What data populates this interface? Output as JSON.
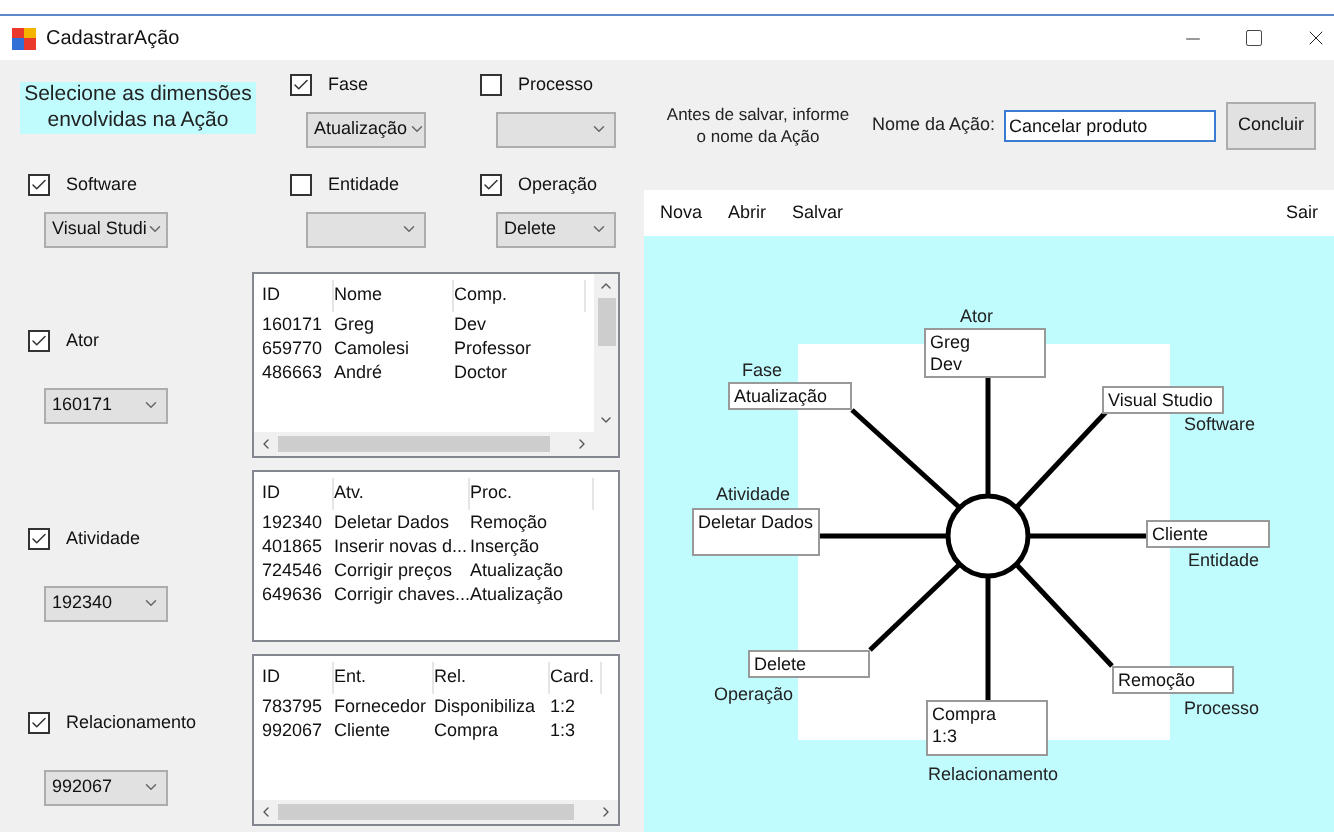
{
  "window": {
    "title": "CadastrarAção"
  },
  "instruction": "Selecione as dimensões envolvidas na Ação",
  "top_dimensions": [
    {
      "label": "Fase",
      "checked": true,
      "value": "Atualização"
    },
    {
      "label": "Processo",
      "checked": false
    },
    {
      "label": "Software",
      "checked": true,
      "value": "Visual Studi"
    },
    {
      "label": "Entidade",
      "checked": false
    },
    {
      "label": "Operação",
      "checked": true,
      "value": "Delete"
    }
  ],
  "table_dimensions": [
    {
      "label": "Ator",
      "checked": true,
      "value": "160171",
      "table": {
        "columns": [
          "ID",
          "Nome",
          "Comp."
        ],
        "rows": [
          [
            "160171",
            "Greg",
            "Dev"
          ],
          [
            "659770",
            "Camolesi",
            "Professor"
          ],
          [
            "486663",
            "André",
            "Doctor"
          ]
        ]
      }
    },
    {
      "label": "Atividade",
      "checked": true,
      "value": "192340",
      "table": {
        "columns": [
          "ID",
          "Atv.",
          "Proc."
        ],
        "rows": [
          [
            "192340",
            "Deletar Dados",
            "Remoção"
          ],
          [
            "401865",
            "Inserir novas d...",
            "Inserção"
          ],
          [
            "724546",
            "Corrigir preços",
            "Atualização"
          ],
          [
            "649636",
            "Corrigir chaves...",
            "Atualização"
          ]
        ]
      }
    },
    {
      "label": "Relacionamento",
      "checked": true,
      "value": "992067",
      "table": {
        "columns": [
          "ID",
          "Ent.",
          "Rel.",
          "Card."
        ],
        "rows": [
          [
            "783795",
            "Fornecedor",
            "Disponibiliza",
            "1:2"
          ],
          [
            "992067",
            "Cliente",
            "Compra",
            "1:3"
          ]
        ]
      }
    }
  ],
  "save_hint": "Antes de salvar, informe o nome da Ação",
  "name_field": {
    "label": "Nome da Ação:",
    "value": "Cancelar produto"
  },
  "confirm_button": "Concluir",
  "menu": {
    "left": [
      "Nova",
      "Abrir",
      "Salvar"
    ],
    "right": [
      "Sair"
    ]
  },
  "diagram": [
    {
      "label": "Ator",
      "lines": [
        "Greg",
        "Dev"
      ]
    },
    {
      "label": "Fase",
      "lines": [
        "Atualização"
      ]
    },
    {
      "label": "Software",
      "lines": [
        "Visual Studio"
      ]
    },
    {
      "label": "Atividade",
      "lines": [
        "Deletar Dados"
      ]
    },
    {
      "label": "Entidade",
      "lines": [
        "Cliente"
      ]
    },
    {
      "label": "Operação",
      "lines": [
        "Delete"
      ]
    },
    {
      "label": "Processo",
      "lines": [
        "Remoção"
      ]
    },
    {
      "label": "Relacionamento",
      "lines": [
        "Compra",
        "1:3"
      ]
    }
  ]
}
